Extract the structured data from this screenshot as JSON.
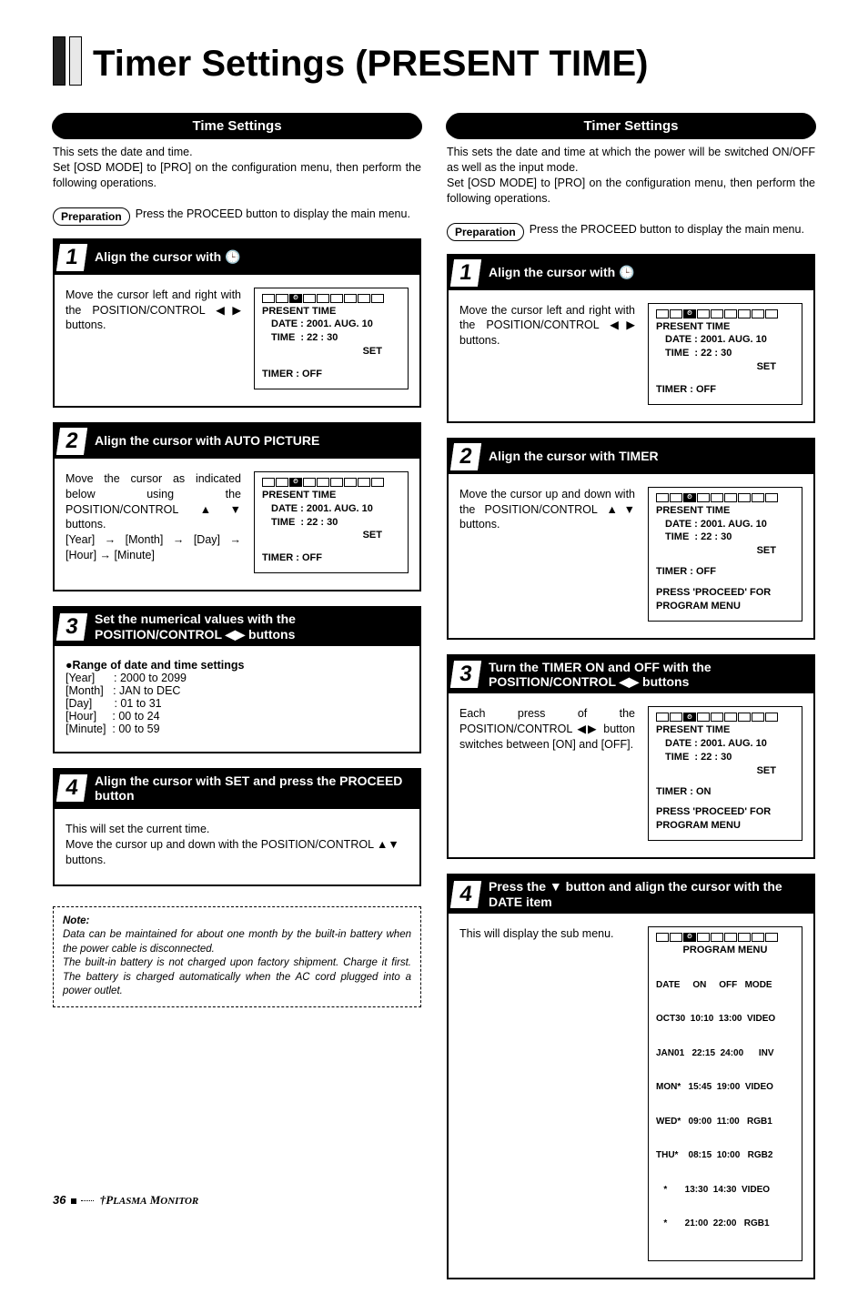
{
  "page_title": "Timer Settings (PRESENT TIME)",
  "left": {
    "pill": "Time Settings",
    "intro": "This sets the date and time.\nSet [OSD MODE] to [PRO] on the configuration menu, then perform the following operations.",
    "prep_label": "Preparation",
    "prep_text": "Press the PROCEED button to display the main menu.",
    "step1": {
      "title": "Align the cursor with",
      "body": "Move the cursor left and right with the POSITION/CONTROL ◀▶ buttons."
    },
    "step2": {
      "title": "Align the cursor with AUTO PICTURE",
      "body": "Move the cursor as indicated below using the POSITION/CONTROL ▲▼ buttons.\n[Year] → [Month] → [Day] → [Hour] → [Minute]"
    },
    "step3": {
      "title": "Set the numerical values with the POSITION/CONTROL ◀▶ buttons",
      "ranges_title": "●Range of date and time settings",
      "r1": "[Year]      : 2000 to 2099",
      "r2": "[Month]   : JAN to DEC",
      "r3": "[Day]       : 01 to 31",
      "r4": "[Hour]     : 00 to 24",
      "r5": "[Minute]  : 00 to 59"
    },
    "step4": {
      "title": "Align the cursor with SET and press the PROCEED button",
      "body": "This will set the current time.\nMove the cursor up and down with the POSITION/CONTROL ▲▼ buttons."
    },
    "osd_present": {
      "l1": "PRESENT TIME",
      "l2": "DATE : 2001. AUG. 10",
      "l3": "TIME  : 22 : 30",
      "l4": "SET",
      "l5": "TIMER : OFF"
    },
    "note_title": "Note:",
    "note_body": "Data can be maintained for about one month by the built-in battery when the power cable is disconnected.\nThe built-in battery is not charged upon factory shipment.  Charge it first. The battery is charged automatically when the AC cord plugged into a power outlet."
  },
  "right": {
    "pill": "Timer Settings",
    "intro": "This sets the date and time at which the power will be switched ON/OFF as well as the input mode.\nSet [OSD MODE] to [PRO] on the configuration menu, then perform the following operations.",
    "prep_label": "Preparation",
    "prep_text": "Press the PROCEED button to display the main menu.",
    "step1": {
      "title": "Align the cursor with",
      "body": "Move the cursor left and right with the POSITION/CONTROL ◀▶ buttons."
    },
    "step2": {
      "title": "Align the cursor with TIMER",
      "body": "Move the cursor up and down with the POSITION/CONTROL ▲▼ buttons."
    },
    "step3": {
      "title": "Turn the TIMER ON and OFF with the POSITION/CONTROL ◀▶ buttons",
      "body": "Each press of the POSITION/CONTROL ◀▶ button switches between [ON] and [OFF]."
    },
    "step4": {
      "title": "Press the ▼ button and align the cursor with the DATE item",
      "body": "This will display the sub menu."
    },
    "osd_present_off": {
      "l1": "PRESENT TIME",
      "l2": "DATE : 2001. AUG. 10",
      "l3": "TIME  : 22 : 30",
      "l4": "SET",
      "l5": "TIMER : OFF"
    },
    "osd_proceed": {
      "l6": "PRESS 'PROCEED' FOR",
      "l7": "PROGRAM MENU"
    },
    "osd_present_on": {
      "l5": "TIMER : ON"
    },
    "program": {
      "title": "PROGRAM MENU",
      "hdr": "DATE     ON     OFF   MODE",
      "r1": "OCT30  10:10  13:00  VIDEO",
      "r2": "JAN01   22:15  24:00      INV",
      "r3": "MON*   15:45  19:00  VIDEO",
      "r4": "WED*   09:00  11:00   RGB1",
      "r5": "THU*    08:15  10:00   RGB2",
      "r6": "   *       13:30  14:30  VIDEO",
      "r7": "   *       21:00  22:00   RGB1"
    }
  },
  "footer": {
    "page": "36",
    "brand": "Plasma Monitor"
  }
}
